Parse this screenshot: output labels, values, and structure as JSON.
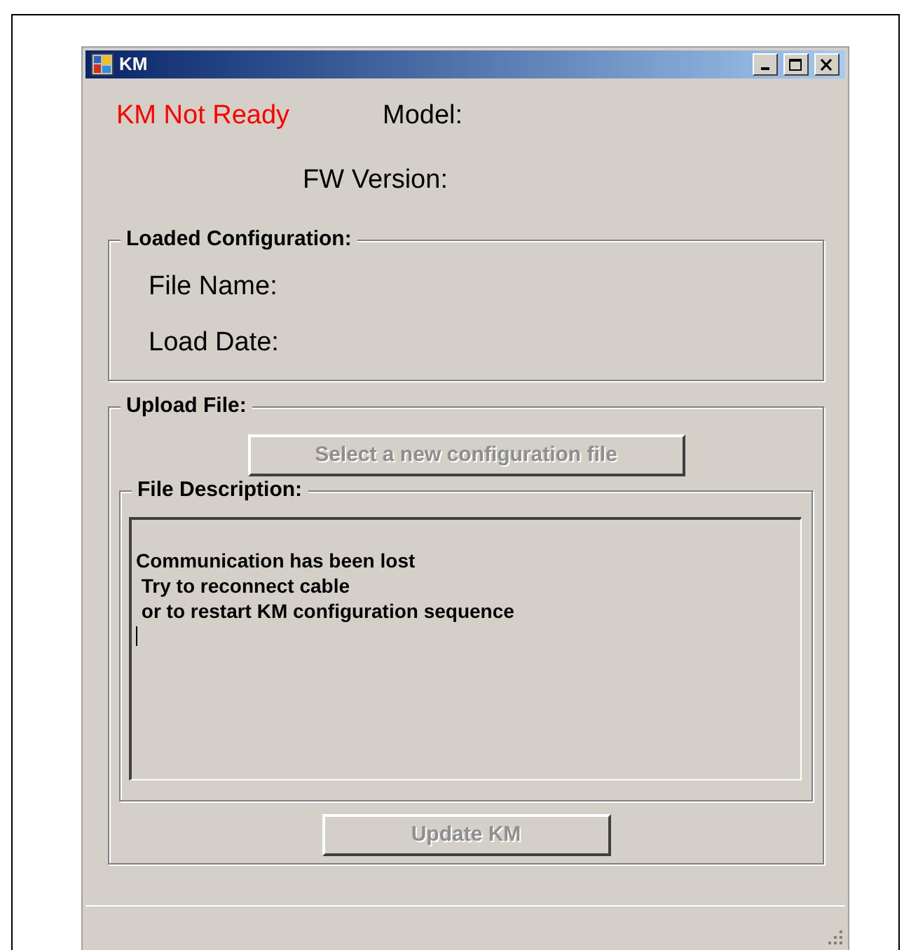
{
  "window": {
    "title": "KM"
  },
  "status": {
    "text": "KM Not Ready"
  },
  "model_label": "Model:",
  "fw_version_label": "FW Version:",
  "loaded_configuration": {
    "title": "Loaded Configuration:",
    "fields": [
      "File Name:",
      "Load Date:"
    ]
  },
  "upload_file": {
    "title": "Upload File:",
    "select_button": {
      "label": "Select a new configuration file",
      "disabled": true
    },
    "file_description": {
      "title": "File Description:",
      "lines": [
        "Communication has been lost",
        " Try to reconnect cable",
        " or to restart KM configuration sequence"
      ]
    },
    "update_button": {
      "label": "Update KM",
      "disabled": true
    }
  }
}
